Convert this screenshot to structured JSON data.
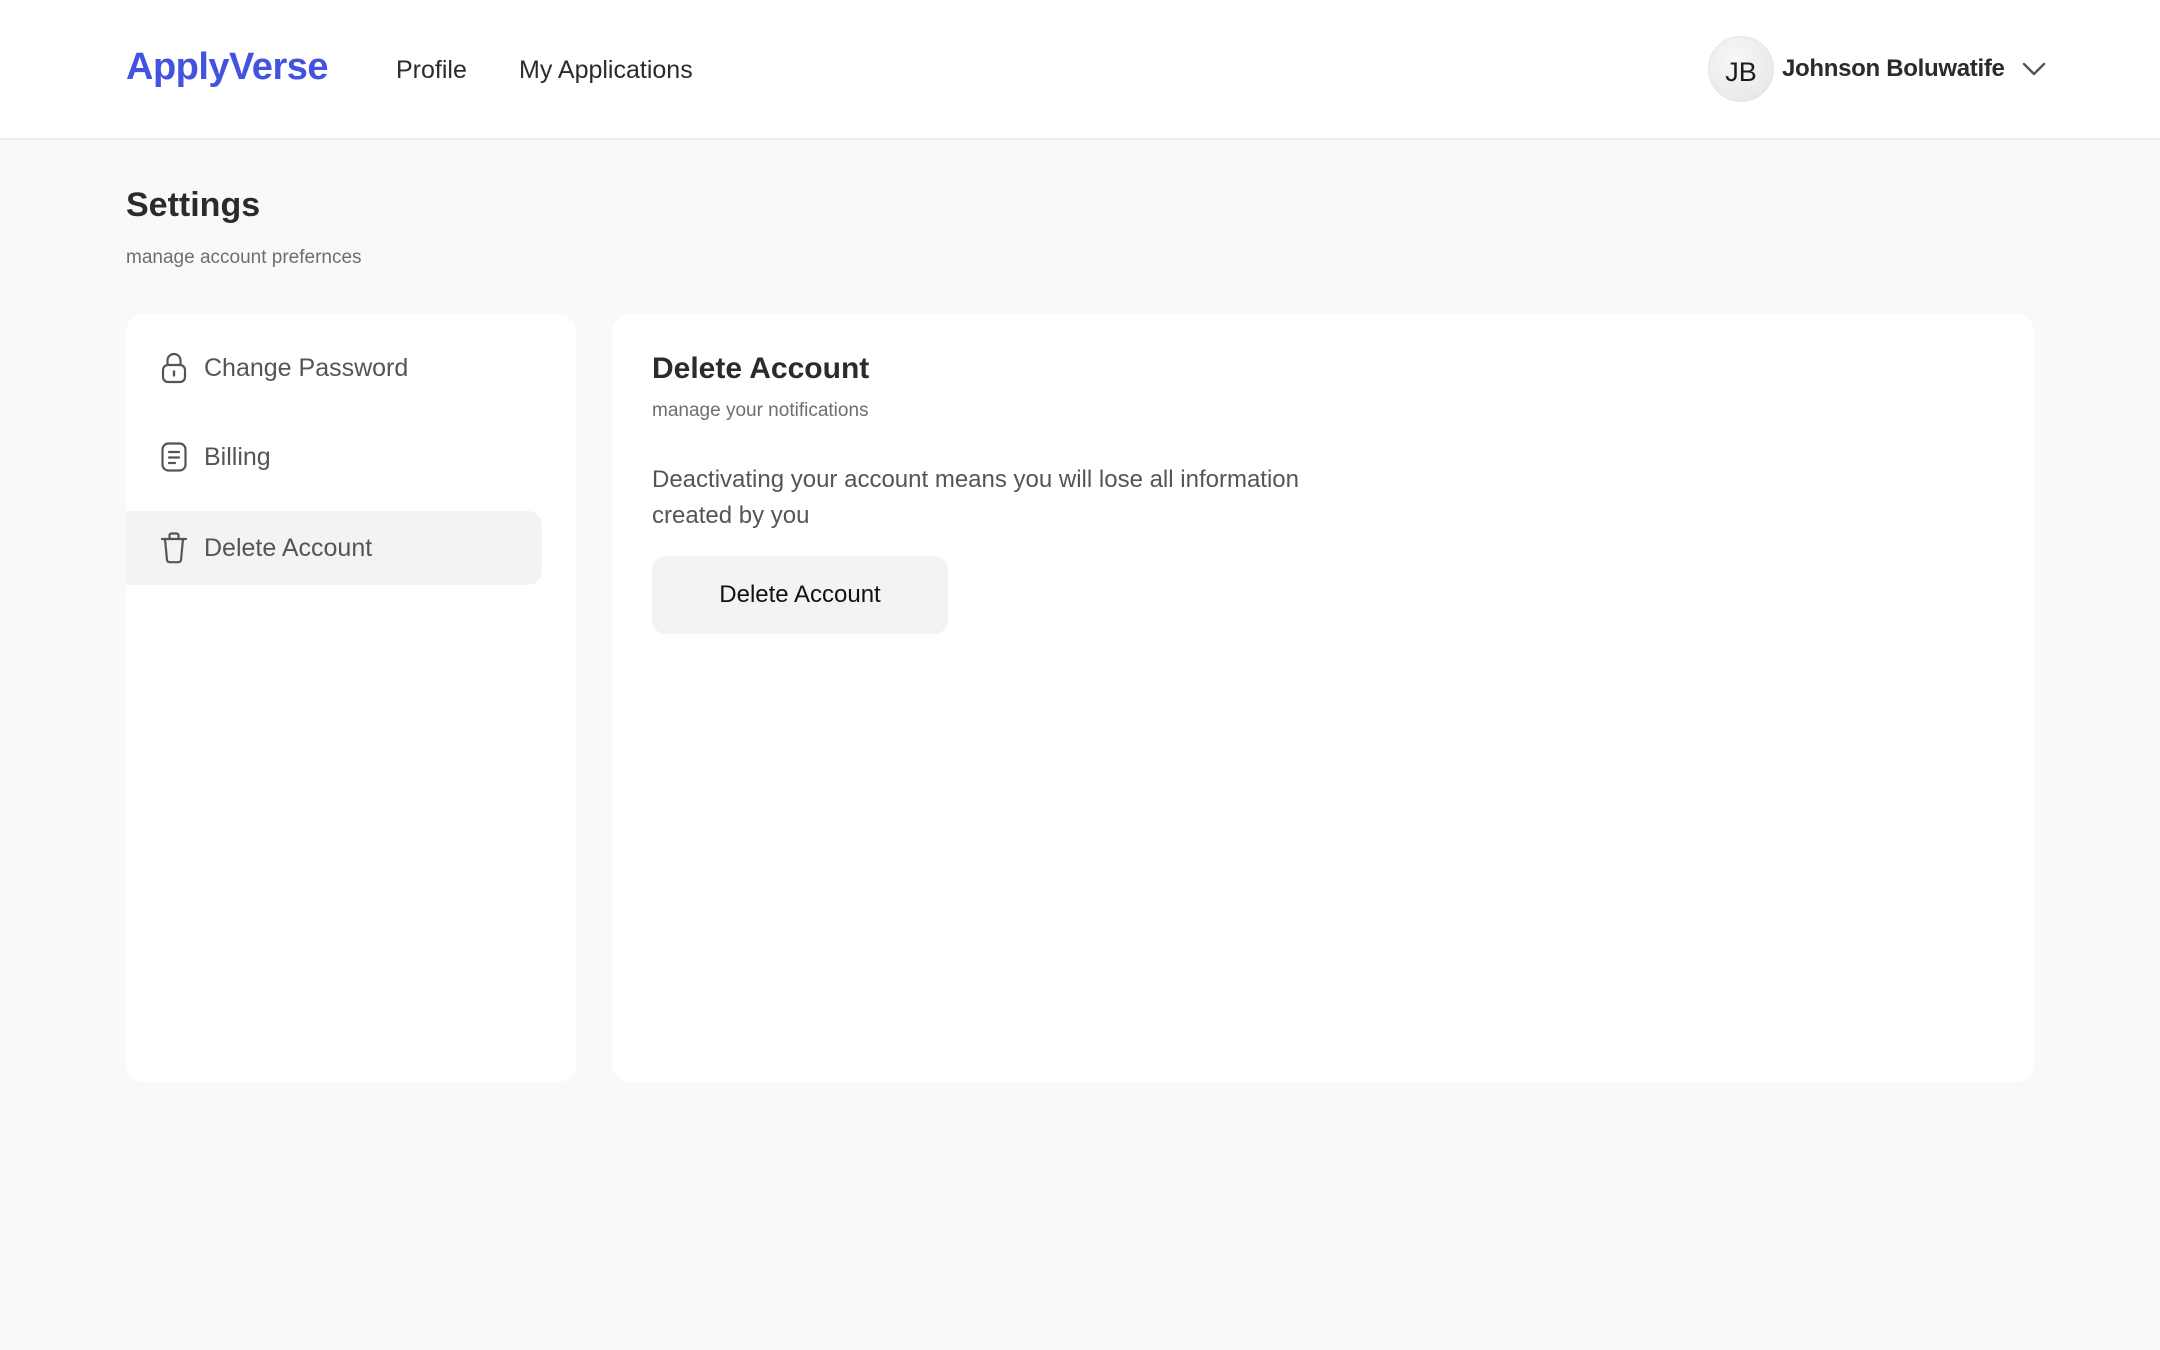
{
  "header": {
    "brand": "ApplyVerse",
    "brand_color": "#4353e0",
    "nav": [
      {
        "label": "Profile"
      },
      {
        "label": "My Applications"
      }
    ],
    "user": {
      "initials": "JB",
      "name": "Johnson Boluwatife",
      "menu_icon": "chevron-down-icon"
    }
  },
  "page": {
    "title": "Settings",
    "subtitle": "manage account prefernces"
  },
  "sidebar": {
    "items": [
      {
        "label": "Change Password",
        "icon": "lock-icon",
        "active": false
      },
      {
        "label": "Billing",
        "icon": "document-icon",
        "active": false
      },
      {
        "label": "Delete Account",
        "icon": "trash-icon",
        "active": true
      }
    ]
  },
  "main": {
    "title": "Delete Account",
    "subtitle": "manage your notifications",
    "description": "Deactivating your account means you will lose all information created by you",
    "button_label": "Delete Account"
  }
}
